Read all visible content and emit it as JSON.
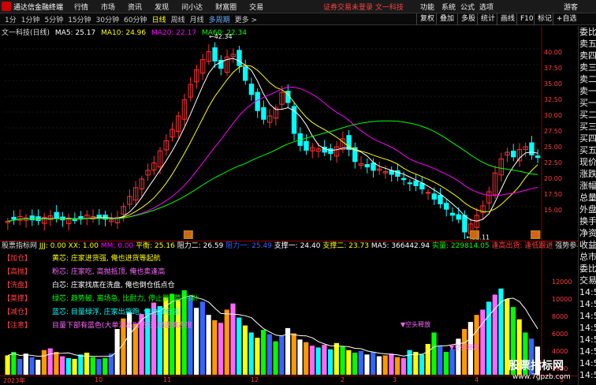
{
  "menubar": {
    "app_name": "通达信金融终端",
    "items": [
      "行情",
      "市场",
      "资讯",
      "发现",
      "问小达",
      "财富圈",
      "交易"
    ],
    "notice": "证券交易未登录  文一科技",
    "tools": [
      "功能",
      "系统",
      "公式",
      "选项",
      "游客"
    ]
  },
  "toolbar": {
    "periods": [
      "1分",
      "1分钟",
      "5分钟",
      "15分钟",
      "30分钟",
      "60分钟",
      "日线",
      "周线",
      "月线",
      "多周期",
      "更多 >"
    ],
    "active_period": "日线",
    "buttons": [
      "复权",
      "叠加",
      "多股",
      "统计",
      "画线",
      "F10",
      "标记",
      "+自选"
    ]
  },
  "ma_line": {
    "title": "文一科技(日线)",
    "ma5": "MA5: 25.17",
    "ma10": "MA10: 24.96",
    "ma20": "MA20: 22.17",
    "ma60": "MA60: 22.34"
  },
  "colors": {
    "up": "#ff3030",
    "down": "#00ffff",
    "ma5": "#ffffff",
    "ma10": "#ffff00",
    "ma20": "#ff00ff",
    "ma60": "#00ff00"
  },
  "price_axis": [
    "40.00",
    "37.50",
    "35.00",
    "32.50",
    "30.00",
    "27.50",
    "25.00",
    "22.50",
    "20.00",
    "17.50",
    "15.00"
  ],
  "annotations": {
    "high": "42.34",
    "low": "12.11"
  },
  "signal_labels": [
    {
      "text": "财"
    },
    {
      "text": "颠"
    },
    {
      "text": "跌"
    },
    {
      "text": "涨"
    },
    {
      "text": "颠"
    }
  ],
  "indicator_header": {
    "name": "股票指标网",
    "jjj": "JJJ: 0.00",
    "xx": "XX: 1.00",
    "mm": "MM: 0.00",
    "ph": "平衡: 25.16",
    "zl2": "阻力二: 26.59",
    "zl1": "阻力一: 25.49",
    "zc1": "支撑一: 24.40",
    "zc2": "支撑二: 23.73",
    "ma5v": "MA5: 366442.94",
    "sl": "实量: 229814.05",
    "fz": "逢高出货: 逢低跟进",
    "qs": "强势参与: 空头释放"
  },
  "legend": [
    {
      "tag": "【加仓】",
      "text": "黄芯: 庄家进货强, 俺也进货等起航",
      "color": "#ffff00"
    },
    {
      "tag": "【高抛】",
      "text": "粉芯: 庄家吃, 高抛抵顶, 俺也卖逢高",
      "color": "#ff66ff"
    },
    {
      "tag": "【洗盘】",
      "text": "白芯: 庄家找底在洗盘, 俺也倒仓低点仓",
      "color": "#ffffff"
    },
    {
      "tag": "【莫撑】",
      "text": "绿芯: 趋势破, 离场急, 比耐力, 停止跌, 莫手痒!",
      "color": "#00ff00"
    },
    {
      "tag": "【减仓】",
      "text": "蓝芯: 目量绿浮, 庄家出货跑, 俺也减仓逃",
      "color": "#00ffff"
    },
    {
      "tag": "【注意】",
      "text": "目量下部有蓝色(大单流出时)应采取谨慎态度",
      "color": "#ff66ff"
    }
  ],
  "vol_labels": [
    "▼空头释放",
    "▼空头释放"
  ],
  "vol_axis": [
    "12000",
    "10000",
    "8000",
    "6000",
    "4000",
    "2000"
  ],
  "time_axis": [
    "2023年",
    "10",
    "11",
    "12",
    "2",
    "3",
    "4",
    "5"
  ],
  "side_panel": [
    "委比",
    "卖五",
    "卖四",
    "卖三",
    "卖二",
    "卖一",
    "买一",
    "买二",
    "买三",
    "买四",
    "买五",
    "现价",
    "涨跌",
    "涨幅",
    "总量",
    "外盘",
    "换手",
    "净资",
    "收益",
    "总市",
    "委比",
    "交易",
    "14:5",
    "14:5",
    "14:5",
    "14:5",
    "14:5",
    "14:5",
    "14:5",
    "14:5"
  ],
  "watermark": {
    "title": "股票指标网",
    "url": "www.7gpzb.com"
  },
  "chart_data": {
    "type": "candlestick",
    "ylim": [
      13,
      43
    ],
    "close_trend": [
      15.3,
      15.6,
      16.0,
      15.8,
      15.5,
      15.4,
      15.9,
      16.1,
      15.7,
      15.5,
      15.6,
      15.4,
      15.8,
      16.2,
      16.0,
      15.7,
      15.6,
      15.5,
      15.9,
      17.5,
      19.0,
      20.3,
      21.6,
      22.9,
      24.0,
      25.8,
      27.3,
      29.0,
      31.0,
      33.4,
      35.7,
      37.9,
      39.4,
      40.6,
      39.2,
      38.1,
      39.8,
      40.2,
      38.5,
      36.3,
      34.2,
      31.8,
      30.5,
      31.0,
      32.2,
      34.5,
      33.0,
      28.4,
      26.6,
      25.9,
      26.3,
      26.1,
      25.6,
      25.4,
      26.4,
      27.6,
      26.0,
      24.2,
      23.9,
      23.4,
      22.9,
      23.1,
      22.7,
      22.3,
      22.0,
      21.5,
      20.9,
      20.6,
      20.1,
      19.6,
      18.6,
      17.9,
      17.1,
      16.2,
      15.6,
      13.7,
      14.9,
      16.2,
      17.6,
      19.7,
      22.5,
      24.6,
      25.6,
      24.9,
      26.0,
      26.4,
      25.2,
      24.8
    ],
    "volume": [
      2200,
      2600,
      1800,
      2400,
      2000,
      1700,
      2800,
      3000,
      2600,
      2100,
      1900,
      1800,
      2300,
      2500,
      2000,
      1800,
      1900,
      2400,
      5200,
      6400,
      7100,
      5800,
      6900,
      7500,
      8200,
      7800,
      8800,
      9200,
      8500,
      9600,
      8900,
      7600,
      8300,
      6800,
      6200,
      5900,
      7400,
      8100,
      6500,
      5600,
      4800,
      4200,
      5100,
      4600,
      3800,
      4400,
      5300,
      4700,
      4000,
      3700,
      3300,
      3100,
      3400,
      2900,
      3600,
      3200,
      2800,
      2500,
      2700,
      2300,
      2600,
      2100,
      2200,
      2400,
      2000,
      1900,
      2800,
      2600,
      2300,
      3500,
      4800,
      3300,
      2600,
      2900,
      4100,
      5200,
      6000,
      6800,
      7400,
      8300,
      9100,
      9800,
      8600,
      7700,
      6300,
      4800,
      4100,
      3200
    ]
  }
}
